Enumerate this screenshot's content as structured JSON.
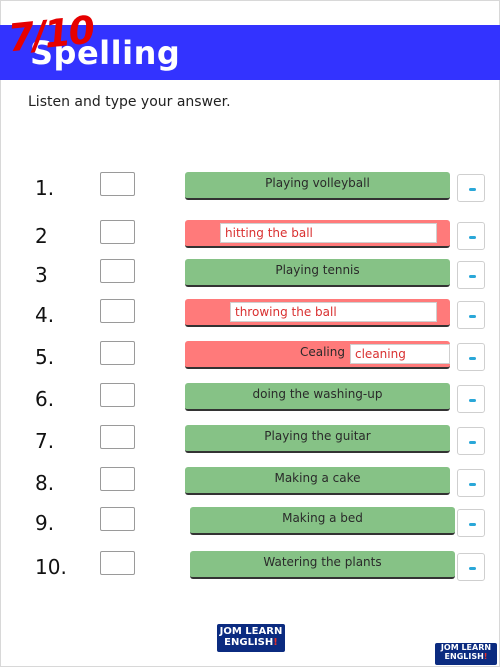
{
  "header": {
    "title": "Spelling",
    "score_overlay": "7/10"
  },
  "instruction": "Listen and type your answer.",
  "items": [
    {
      "number": "1.",
      "answer": "Playing volleyball",
      "status": "correct",
      "typed": ""
    },
    {
      "number": "2",
      "answer": "",
      "status": "incorrect",
      "typed": "hitting the ball"
    },
    {
      "number": "3",
      "answer": "Playing tennis",
      "status": "correct",
      "typed": ""
    },
    {
      "number": "4.",
      "answer": "",
      "status": "incorrect",
      "typed": "throwing the ball"
    },
    {
      "number": "5.",
      "answer": "Cealing",
      "status": "incorrect",
      "typed": "cleaning"
    },
    {
      "number": "6.",
      "answer": "doing the washing-up",
      "status": "correct",
      "typed": ""
    },
    {
      "number": "7.",
      "answer": "Playing the guitar",
      "status": "correct",
      "typed": ""
    },
    {
      "number": "8.",
      "answer": "Making a cake",
      "status": "correct",
      "typed": ""
    },
    {
      "number": "9.",
      "answer": "Making a bed",
      "status": "correct",
      "typed": ""
    },
    {
      "number": "10.",
      "answer": "Watering the plants",
      "status": "correct",
      "typed": ""
    }
  ],
  "logos": {
    "line1": "JOM LEARN",
    "line2": "ENGLISH",
    "mark": "!"
  },
  "colors": {
    "header": "#3333ff",
    "correct": "#86c286",
    "incorrect": "#ff7a7a",
    "score": "#e60000"
  }
}
